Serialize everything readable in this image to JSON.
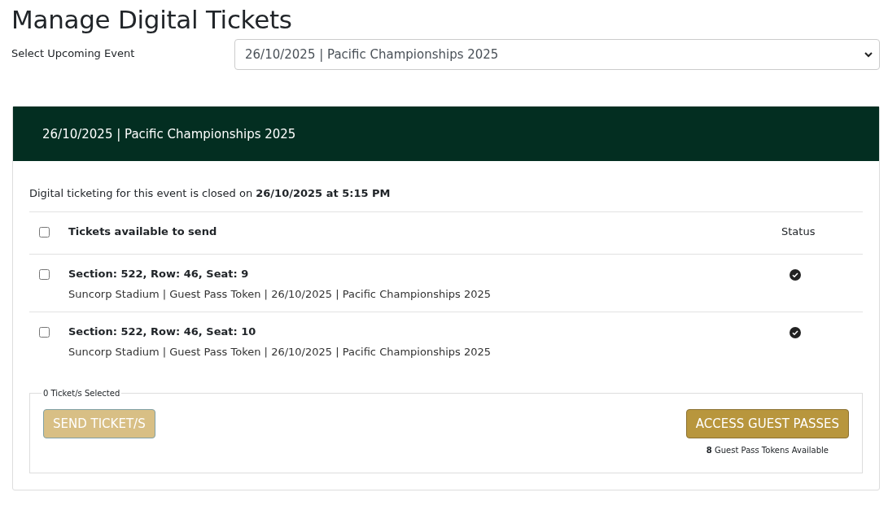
{
  "page_title": "Manage Digital Tickets",
  "event_select": {
    "label": "Select Upcoming Event",
    "value": "26/10/2025 | Pacific Championships 2025"
  },
  "card": {
    "header": "26/10/2025 | Pacific Championships 2025",
    "notice": "Digital ticketing for this event is closed on **26/10/2025 at 5:15 PM**",
    "table": {
      "select_all": {
        "checked": false
      },
      "columns": [
        "Tickets available to send",
        "Status"
      ],
      "rows": [
        {
          "checked": false,
          "title": "Section: 522, Row: 46, Seat: 9",
          "details": "Suncorp Stadium | Guest Pass Token | 26/10/2025 | Pacific Championships 2025"
        },
        {
          "checked": false,
          "title": "Section: 522, Row: 46, Seat: 10",
          "details": "Suncorp Stadium | Guest Pass Token | 26/10/2025 | Pacific Championships 2025"
        }
      ]
    },
    "selection": {
      "legend": "0 Ticket/s Selected",
      "send_button": {
        "label": "SEND TICKET/S",
        "disabled": true
      },
      "access_button": {
        "label": "ACCESS GUEST PASSES"
      },
      "tokens_note": "**8** Guest Pass Tokens Available"
    }
  }
}
